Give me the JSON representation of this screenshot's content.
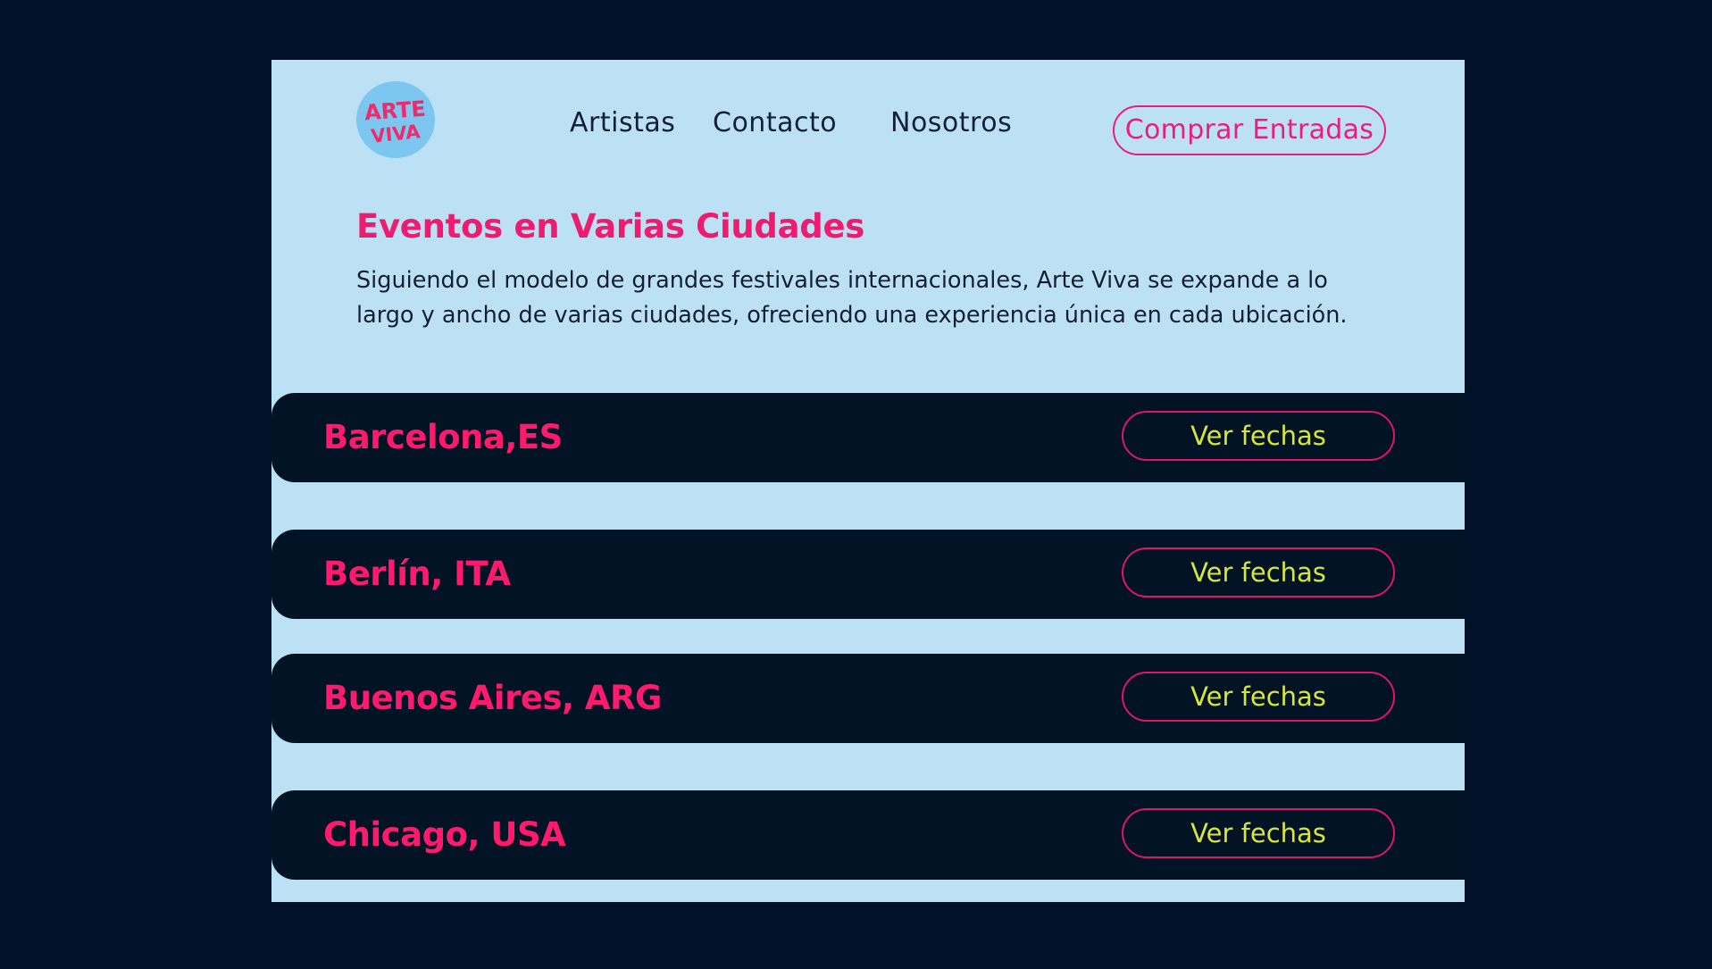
{
  "brand": {
    "logo_line1": "ARTE",
    "logo_line2": "VIVA"
  },
  "nav": {
    "items": [
      {
        "label": "Artistas"
      },
      {
        "label": "Contacto"
      },
      {
        "label": "Nosotros"
      }
    ],
    "cta_label": "Comprar Entradas"
  },
  "intro": {
    "title": "Eventos en Varias Ciudades",
    "description": "Siguiendo el modelo de grandes festivales internacionales, Arte Viva se expande a lo largo y ancho de varias ciudades, ofreciendo una experiencia única en cada ubicación."
  },
  "cities": [
    {
      "name": "Barcelona,ES",
      "button": "Ver fechas"
    },
    {
      "name": "Berlín, ITA",
      "button": "Ver fechas"
    },
    {
      "name": "Buenos Aires, ARG",
      "button": "Ver fechas"
    },
    {
      "name": "Chicago, USA",
      "button": "Ver fechas"
    }
  ],
  "colors": {
    "page_background": "#011228",
    "panel_background": "#bde1f4",
    "accent_pink": "#ee1c6f",
    "button_text_yellow": "#d8e63a",
    "city_bar": "#011325"
  }
}
